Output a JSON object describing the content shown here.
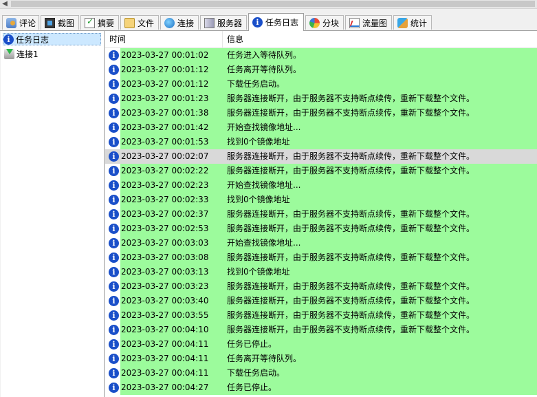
{
  "tabs": [
    {
      "label": "评论",
      "icon": "comment-icon"
    },
    {
      "label": "截图",
      "icon": "screenshot-icon"
    },
    {
      "label": "摘要",
      "icon": "summary-icon"
    },
    {
      "label": "文件",
      "icon": "file-icon"
    },
    {
      "label": "连接",
      "icon": "connection-icon"
    },
    {
      "label": "服务器",
      "icon": "server-icon"
    },
    {
      "label": "任务日志",
      "icon": "task-log-icon",
      "active": true
    },
    {
      "label": "分块",
      "icon": "block-icon"
    },
    {
      "label": "流量图",
      "icon": "flowchart-icon"
    },
    {
      "label": "统计",
      "icon": "stats-icon"
    }
  ],
  "tree": {
    "items": [
      {
        "label": "任务日志",
        "icon": "info-icon",
        "selected": true
      },
      {
        "label": "连接1",
        "icon": "connection-node-icon"
      }
    ]
  },
  "log": {
    "columns": {
      "time": "时间",
      "message": "信息"
    },
    "row_color": "#9cfb9c",
    "selected_color": "#d9d9d9",
    "rows": [
      {
        "time": "2023-03-27 00:01:02",
        "message": "任务进入等待队列。"
      },
      {
        "time": "2023-03-27 00:01:12",
        "message": "任务离开等待队列。"
      },
      {
        "time": "2023-03-27 00:01:12",
        "message": "下载任务启动。"
      },
      {
        "time": "2023-03-27 00:01:23",
        "message": "服务器连接断开，由于服务器不支持断点续传，重新下载整个文件。"
      },
      {
        "time": "2023-03-27 00:01:38",
        "message": "服务器连接断开，由于服务器不支持断点续传，重新下载整个文件。"
      },
      {
        "time": "2023-03-27 00:01:42",
        "message": "开始查找镜像地址..."
      },
      {
        "time": "2023-03-27 00:01:53",
        "message": "找到0个镜像地址"
      },
      {
        "time": "2023-03-27 00:02:07",
        "message": "服务器连接断开，由于服务器不支持断点续传，重新下载整个文件。",
        "selected": true
      },
      {
        "time": "2023-03-27 00:02:22",
        "message": "服务器连接断开，由于服务器不支持断点续传，重新下载整个文件。"
      },
      {
        "time": "2023-03-27 00:02:23",
        "message": "开始查找镜像地址..."
      },
      {
        "time": "2023-03-27 00:02:33",
        "message": "找到0个镜像地址"
      },
      {
        "time": "2023-03-27 00:02:37",
        "message": "服务器连接断开，由于服务器不支持断点续传，重新下载整个文件。"
      },
      {
        "time": "2023-03-27 00:02:53",
        "message": "服务器连接断开，由于服务器不支持断点续传，重新下载整个文件。"
      },
      {
        "time": "2023-03-27 00:03:03",
        "message": "开始查找镜像地址..."
      },
      {
        "time": "2023-03-27 00:03:08",
        "message": "服务器连接断开，由于服务器不支持断点续传，重新下载整个文件。"
      },
      {
        "time": "2023-03-27 00:03:13",
        "message": "找到0个镜像地址"
      },
      {
        "time": "2023-03-27 00:03:23",
        "message": "服务器连接断开，由于服务器不支持断点续传，重新下载整个文件。"
      },
      {
        "time": "2023-03-27 00:03:40",
        "message": "服务器连接断开，由于服务器不支持断点续传，重新下载整个文件。"
      },
      {
        "time": "2023-03-27 00:03:55",
        "message": "服务器连接断开，由于服务器不支持断点续传，重新下载整个文件。"
      },
      {
        "time": "2023-03-27 00:04:10",
        "message": "服务器连接断开，由于服务器不支持断点续传，重新下载整个文件。"
      },
      {
        "time": "2023-03-27 00:04:11",
        "message": "任务已停止。"
      },
      {
        "time": "2023-03-27 00:04:11",
        "message": "任务离开等待队列。"
      },
      {
        "time": "2023-03-27 00:04:11",
        "message": "下载任务启动。"
      },
      {
        "time": "2023-03-27 00:04:27",
        "message": "任务已停止。"
      }
    ]
  }
}
